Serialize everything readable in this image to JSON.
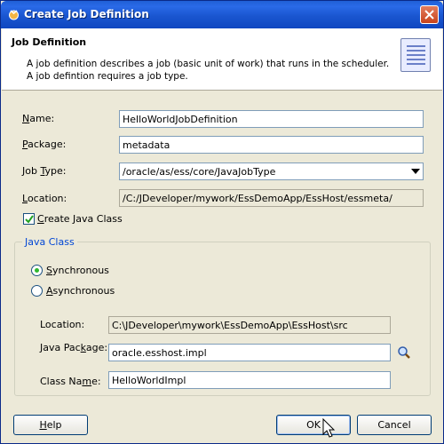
{
  "window": {
    "title": "Create Job Definition"
  },
  "header": {
    "title": "Job Definition",
    "description": "A job definition describes a job (basic unit of work) that runs in the scheduler.  A job defintion requires a job type."
  },
  "form": {
    "name": {
      "label_key": "N",
      "label_rest": "ame:",
      "value": "HelloWorldJobDefinition"
    },
    "package": {
      "label_key": "P",
      "label_rest": "ackage:",
      "value": "metadata"
    },
    "job_type": {
      "label_pre": "Job ",
      "label_key": "T",
      "label_rest": "ype:",
      "value": "/oracle/as/ess/core/JavaJobType"
    },
    "location": {
      "label_key": "L",
      "label_rest": "ocation:",
      "value": "/C:/JDeveloper/mywork/EssDemoApp/EssHost/essmeta/"
    },
    "create_java_class": {
      "label_key": "C",
      "label_rest": "reate Java Class",
      "checked": true
    }
  },
  "java_class": {
    "legend": "Java Class",
    "synchronous": {
      "label_key": "S",
      "label_rest": "ynchronous",
      "selected": true
    },
    "asynchronous": {
      "label_key": "A",
      "label_rest": "synchronous",
      "selected": false
    },
    "location": {
      "label": "Location:",
      "value": "C:\\JDeveloper\\mywork\\EssDemoApp\\EssHost\\src"
    },
    "java_package": {
      "label_pre": "Java Pac",
      "label_key": "k",
      "label_rest": "age:",
      "value": "oracle.esshost.impl"
    },
    "class_name": {
      "label_pre": "Class Na",
      "label_key": "m",
      "label_rest": "e:",
      "value": "HelloWorldImpl"
    }
  },
  "buttons": {
    "help": {
      "label_key": "H",
      "label_rest": "elp"
    },
    "ok": "OK",
    "cancel": "Cancel"
  },
  "icons": {
    "title_icon": "oracle-jdev-icon",
    "close": "close-icon",
    "header_icon": "document-list-icon",
    "search": "search-icon"
  }
}
